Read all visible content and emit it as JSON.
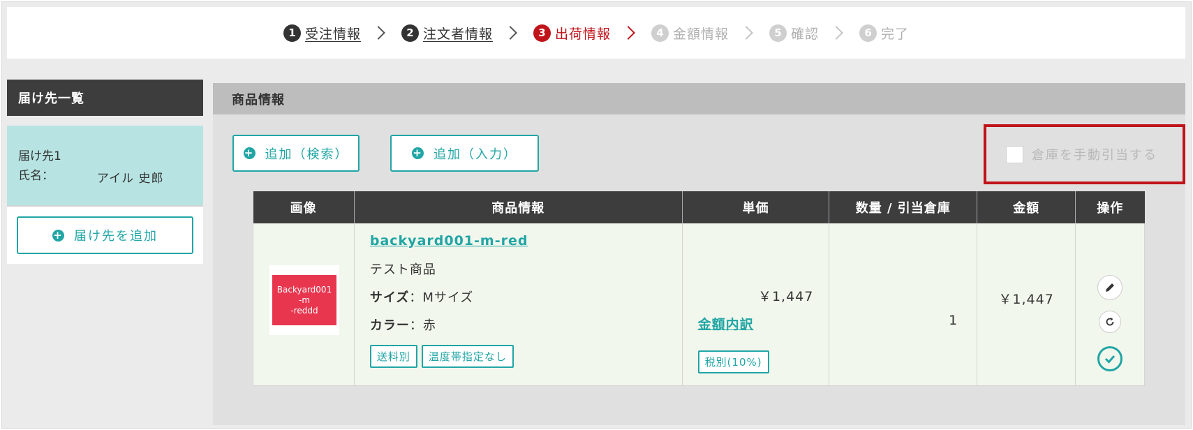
{
  "steps": [
    {
      "num": "1",
      "label": "受注情報",
      "state": "done"
    },
    {
      "num": "2",
      "label": "注文者情報",
      "state": "done"
    },
    {
      "num": "3",
      "label": "出荷情報",
      "state": "active"
    },
    {
      "num": "4",
      "label": "金額情報",
      "state": "todo"
    },
    {
      "num": "5",
      "label": "確認",
      "state": "todo"
    },
    {
      "num": "6",
      "label": "完了",
      "state": "todo"
    }
  ],
  "sidebar": {
    "title": "届け先一覧",
    "destination": {
      "label": "届け先1",
      "name_label": "氏名：",
      "name_value": "アイル 史郎"
    },
    "add_button": "届け先を追加"
  },
  "main": {
    "title": "商品情報",
    "add_search": "追加（検索）",
    "add_input": "追加（入力）",
    "manual_allocation": "倉庫を手動引当する",
    "manual_checked": false
  },
  "table": {
    "headers": [
      "画像",
      "商品情報",
      "単価",
      "数量 / 引当倉庫",
      "金額",
      "操作"
    ],
    "rows": [
      {
        "image_text": [
          "Backyard001",
          "-m",
          "-reddd"
        ],
        "code": "backyard001-m-red",
        "name": "テスト商品",
        "size_label": "サイズ",
        "size_value": "：Mサイズ",
        "color_label": "カラー",
        "color_value": "：赤",
        "tags": [
          "送料別",
          "温度帯指定なし"
        ],
        "unit_price": "￥1,447",
        "price_breakdown": "金額内訳",
        "tax": "税別(10%)",
        "qty": "1",
        "amount": "￥1,447"
      }
    ]
  },
  "colors": {
    "accent": "#21a5a5",
    "active": "#c0141b",
    "header": "#3d3d3d",
    "highlight_border": "#c0141b"
  }
}
